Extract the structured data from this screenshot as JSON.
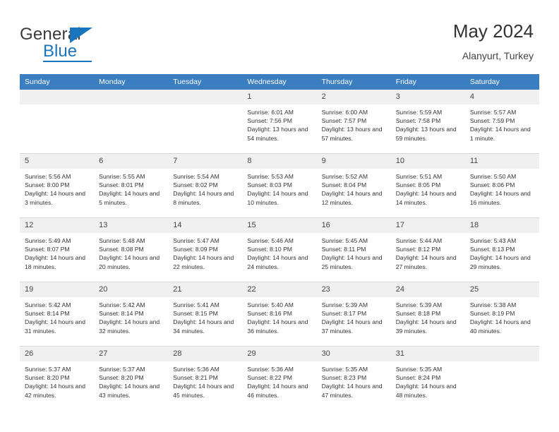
{
  "brand": {
    "name_part1": "General",
    "name_part2": "Blue",
    "flag_icon": "triangle-flag-icon"
  },
  "header": {
    "title": "May 2024",
    "location": "Alanyurt, Turkey"
  },
  "colors": {
    "header_bar": "#3a7dc0",
    "brand_blue": "#1b75bc",
    "daynum_bg": "#f0f0f0",
    "cell_bg": "#ffffff",
    "text": "#333333"
  },
  "weekday_headers": [
    "Sunday",
    "Monday",
    "Tuesday",
    "Wednesday",
    "Thursday",
    "Friday",
    "Saturday"
  ],
  "labels": {
    "sunrise": "Sunrise:",
    "sunset": "Sunset:",
    "daylight": "Daylight:"
  },
  "weeks": [
    [
      {
        "day": "",
        "blank": true
      },
      {
        "day": "",
        "blank": true
      },
      {
        "day": "",
        "blank": true
      },
      {
        "day": "1",
        "sunrise": "Sunrise: 6:01 AM",
        "sunset": "Sunset: 7:56 PM",
        "daylight": "Daylight: 13 hours and 54 minutes."
      },
      {
        "day": "2",
        "sunrise": "Sunrise: 6:00 AM",
        "sunset": "Sunset: 7:57 PM",
        "daylight": "Daylight: 13 hours and 57 minutes."
      },
      {
        "day": "3",
        "sunrise": "Sunrise: 5:59 AM",
        "sunset": "Sunset: 7:58 PM",
        "daylight": "Daylight: 13 hours and 59 minutes."
      },
      {
        "day": "4",
        "sunrise": "Sunrise: 5:57 AM",
        "sunset": "Sunset: 7:59 PM",
        "daylight": "Daylight: 14 hours and 1 minute."
      }
    ],
    [
      {
        "day": "5",
        "sunrise": "Sunrise: 5:56 AM",
        "sunset": "Sunset: 8:00 PM",
        "daylight": "Daylight: 14 hours and 3 minutes."
      },
      {
        "day": "6",
        "sunrise": "Sunrise: 5:55 AM",
        "sunset": "Sunset: 8:01 PM",
        "daylight": "Daylight: 14 hours and 5 minutes."
      },
      {
        "day": "7",
        "sunrise": "Sunrise: 5:54 AM",
        "sunset": "Sunset: 8:02 PM",
        "daylight": "Daylight: 14 hours and 8 minutes."
      },
      {
        "day": "8",
        "sunrise": "Sunrise: 5:53 AM",
        "sunset": "Sunset: 8:03 PM",
        "daylight": "Daylight: 14 hours and 10 minutes."
      },
      {
        "day": "9",
        "sunrise": "Sunrise: 5:52 AM",
        "sunset": "Sunset: 8:04 PM",
        "daylight": "Daylight: 14 hours and 12 minutes."
      },
      {
        "day": "10",
        "sunrise": "Sunrise: 5:51 AM",
        "sunset": "Sunset: 8:05 PM",
        "daylight": "Daylight: 14 hours and 14 minutes."
      },
      {
        "day": "11",
        "sunrise": "Sunrise: 5:50 AM",
        "sunset": "Sunset: 8:06 PM",
        "daylight": "Daylight: 14 hours and 16 minutes."
      }
    ],
    [
      {
        "day": "12",
        "sunrise": "Sunrise: 5:49 AM",
        "sunset": "Sunset: 8:07 PM",
        "daylight": "Daylight: 14 hours and 18 minutes."
      },
      {
        "day": "13",
        "sunrise": "Sunrise: 5:48 AM",
        "sunset": "Sunset: 8:08 PM",
        "daylight": "Daylight: 14 hours and 20 minutes."
      },
      {
        "day": "14",
        "sunrise": "Sunrise: 5:47 AM",
        "sunset": "Sunset: 8:09 PM",
        "daylight": "Daylight: 14 hours and 22 minutes."
      },
      {
        "day": "15",
        "sunrise": "Sunrise: 5:46 AM",
        "sunset": "Sunset: 8:10 PM",
        "daylight": "Daylight: 14 hours and 24 minutes."
      },
      {
        "day": "16",
        "sunrise": "Sunrise: 5:45 AM",
        "sunset": "Sunset: 8:11 PM",
        "daylight": "Daylight: 14 hours and 25 minutes."
      },
      {
        "day": "17",
        "sunrise": "Sunrise: 5:44 AM",
        "sunset": "Sunset: 8:12 PM",
        "daylight": "Daylight: 14 hours and 27 minutes."
      },
      {
        "day": "18",
        "sunrise": "Sunrise: 5:43 AM",
        "sunset": "Sunset: 8:13 PM",
        "daylight": "Daylight: 14 hours and 29 minutes."
      }
    ],
    [
      {
        "day": "19",
        "sunrise": "Sunrise: 5:42 AM",
        "sunset": "Sunset: 8:14 PM",
        "daylight": "Daylight: 14 hours and 31 minutes."
      },
      {
        "day": "20",
        "sunrise": "Sunrise: 5:42 AM",
        "sunset": "Sunset: 8:14 PM",
        "daylight": "Daylight: 14 hours and 32 minutes."
      },
      {
        "day": "21",
        "sunrise": "Sunrise: 5:41 AM",
        "sunset": "Sunset: 8:15 PM",
        "daylight": "Daylight: 14 hours and 34 minutes."
      },
      {
        "day": "22",
        "sunrise": "Sunrise: 5:40 AM",
        "sunset": "Sunset: 8:16 PM",
        "daylight": "Daylight: 14 hours and 36 minutes."
      },
      {
        "day": "23",
        "sunrise": "Sunrise: 5:39 AM",
        "sunset": "Sunset: 8:17 PM",
        "daylight": "Daylight: 14 hours and 37 minutes."
      },
      {
        "day": "24",
        "sunrise": "Sunrise: 5:39 AM",
        "sunset": "Sunset: 8:18 PM",
        "daylight": "Daylight: 14 hours and 39 minutes."
      },
      {
        "day": "25",
        "sunrise": "Sunrise: 5:38 AM",
        "sunset": "Sunset: 8:19 PM",
        "daylight": "Daylight: 14 hours and 40 minutes."
      }
    ],
    [
      {
        "day": "26",
        "sunrise": "Sunrise: 5:37 AM",
        "sunset": "Sunset: 8:20 PM",
        "daylight": "Daylight: 14 hours and 42 minutes."
      },
      {
        "day": "27",
        "sunrise": "Sunrise: 5:37 AM",
        "sunset": "Sunset: 8:20 PM",
        "daylight": "Daylight: 14 hours and 43 minutes."
      },
      {
        "day": "28",
        "sunrise": "Sunrise: 5:36 AM",
        "sunset": "Sunset: 8:21 PM",
        "daylight": "Daylight: 14 hours and 45 minutes."
      },
      {
        "day": "29",
        "sunrise": "Sunrise: 5:36 AM",
        "sunset": "Sunset: 8:22 PM",
        "daylight": "Daylight: 14 hours and 46 minutes."
      },
      {
        "day": "30",
        "sunrise": "Sunrise: 5:35 AM",
        "sunset": "Sunset: 8:23 PM",
        "daylight": "Daylight: 14 hours and 47 minutes."
      },
      {
        "day": "31",
        "sunrise": "Sunrise: 5:35 AM",
        "sunset": "Sunset: 8:24 PM",
        "daylight": "Daylight: 14 hours and 48 minutes."
      },
      {
        "day": "",
        "blank": true
      }
    ]
  ]
}
